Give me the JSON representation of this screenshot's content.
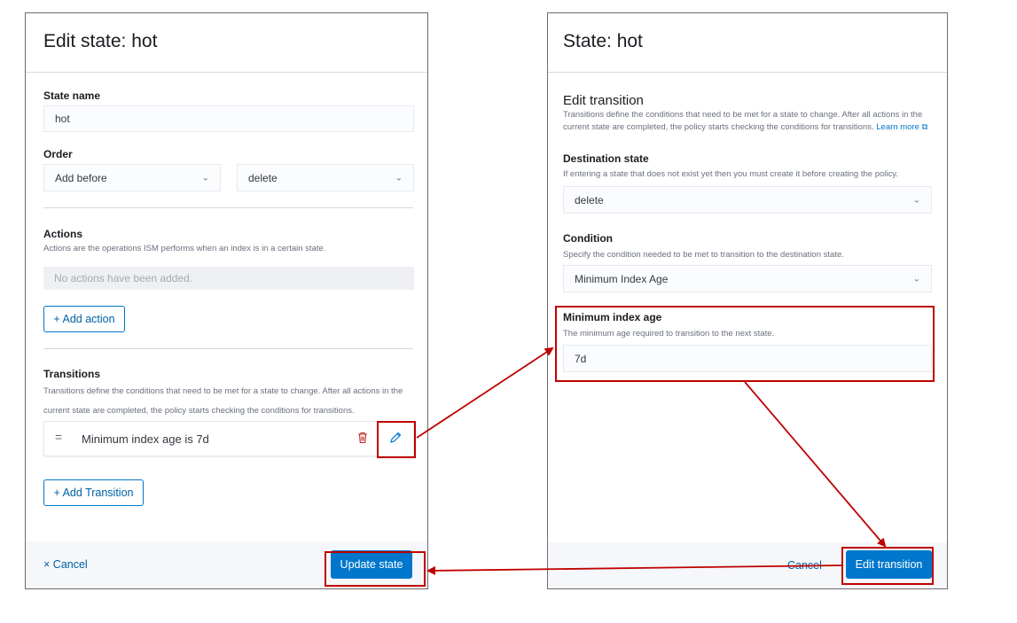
{
  "left": {
    "title": "Edit state: hot",
    "state_name_label": "State name",
    "state_name_value": "hot",
    "order_label": "Order",
    "order_position": "Add before",
    "order_target": "delete",
    "actions_label": "Actions",
    "actions_help": "Actions are the operations ISM performs when an index is in a certain state.",
    "actions_empty": "No actions have been added.",
    "add_action": "+ Add action",
    "transitions_label": "Transitions",
    "transitions_help": "Transitions define the conditions that need to be met for a state to change. After all actions in the current state are completed, the policy starts checking the conditions for transitions.",
    "transition_item": "Minimum index age is 7d",
    "add_transition": "+ Add Transition",
    "cancel": "Cancel",
    "update_state": "Update state"
  },
  "right": {
    "title": "State: hot",
    "edit_transition_heading": "Edit transition",
    "edit_transition_help": "Transitions define the conditions that need to be met for a state to change. After all actions in the current state are completed, the policy starts checking the conditions for transitions.",
    "learn_more": "Learn more",
    "destination_label": "Destination state",
    "destination_help": "If entering a state that does not exist yet then you must create it before creating the policy.",
    "destination_value": "delete",
    "condition_label": "Condition",
    "condition_help": "Specify the condition needed to be met to transition to the destination state.",
    "condition_value": "Minimum Index Age",
    "min_age_label": "Minimum index age",
    "min_age_help": "The minimum age required to transition to the next state.",
    "min_age_value": "7d",
    "cancel": "Cancel",
    "edit_transition_button": "Edit transition"
  },
  "colors": {
    "accent": "#0077cc",
    "highlight": "#c00000",
    "danger": "#bd271e"
  }
}
